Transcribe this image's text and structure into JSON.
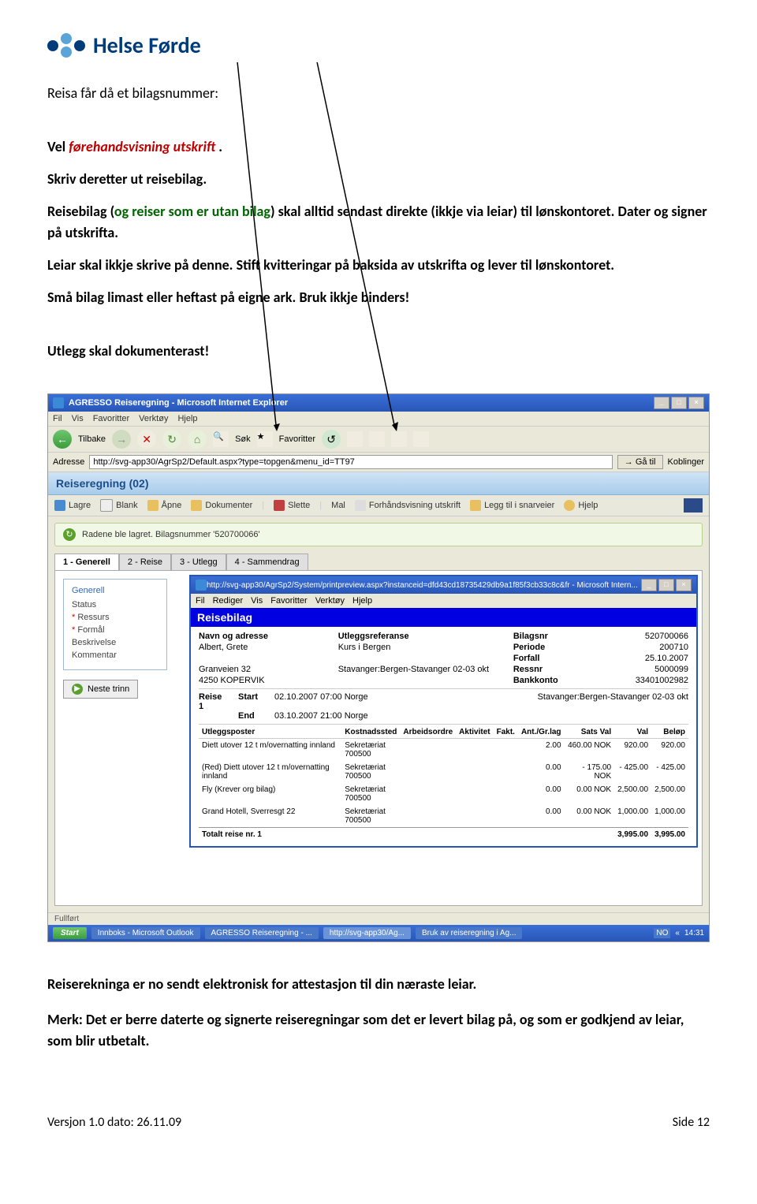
{
  "logo_text": "Helse Førde",
  "doc": {
    "p1": "Reisa får då et bilagsnummer:",
    "p2_pre": "Vel ",
    "p2_red": "førehandsvisning utskrift",
    "p2_post": " .",
    "p3": "Skriv deretter ut reisebilag.",
    "p4_pre": "Reisebilag (",
    "p4_green": "og reiser som er utan bilag",
    "p4_post": ") skal alltid sendast direkte (ikkje via leiar) til lønskontoret. Dater og signer på utskrifta.",
    "p5": "Leiar skal ikkje skrive på denne. Stift kvitteringar på baksida av utskrifta og lever til lønskontoret.",
    "p6": "Små bilag limast eller heftast på eigne ark. Bruk ikkje binders!",
    "p7": "Utlegg skal dokumenterast!"
  },
  "ie": {
    "title": "AGRESSO Reiseregning - Microsoft Internet Explorer",
    "menu": [
      "Fil",
      "Vis",
      "Favoritter",
      "Verktøy",
      "Hjelp"
    ],
    "back_label": "Tilbake",
    "sok_label": "Søk",
    "fav_label": "Favoritter",
    "addr_label": "Adresse",
    "addr_value": "http://svg-app30/AgrSp2/Default.aspx?type=topgen&menu_id=TT97",
    "go_label": "Gå til",
    "koblinger": "Koblinger"
  },
  "app": {
    "header": "Reiseregning (02)",
    "toolbar": {
      "lagre": "Lagre",
      "blank": "Blank",
      "apne": "Åpne",
      "dokumenter": "Dokumenter",
      "slette": "Slette",
      "mal": "Mal",
      "forhands": "Forhåndsvisning utskrift",
      "snarveier": "Legg til i snarveier",
      "hjelp": "Hjelp"
    },
    "status_msg": "Radene ble lagret. Bilagsnummer '520700066'",
    "tabs": [
      "1 - Generell",
      "2 - Reise",
      "3 - Utlegg",
      "4 - Sammendrag"
    ],
    "fieldset": {
      "legend": "Generell",
      "status": "Status",
      "ressurs": "Ressurs",
      "formal": "Formål",
      "beskrivelse": "Beskrivelse",
      "kommentar": "Kommentar"
    },
    "neste": "Neste trinn"
  },
  "subwin": {
    "title": "http://svg-app30/AgrSp2/System/printpreview.aspx?instanceid=dfd43cd18735429db9a1f85f3cb33c8c&fr - Microsoft Intern...",
    "menu": [
      "Fil",
      "Rediger",
      "Vis",
      "Favoritter",
      "Verktøy",
      "Hjelp"
    ],
    "header": "Reisebilag",
    "labels": {
      "navn": "Navn og adresse",
      "utleggsref": "Utleggsreferanse",
      "bilagsnr": "Bilagsnr",
      "periode": "Periode",
      "forfall": "Forfall",
      "ressnr": "Ressnr",
      "bankkonto": "Bankkonto"
    },
    "values": {
      "navn": "Albert, Grete",
      "addr1": "Granveien 32",
      "addr2": "4250 KOPERVIK",
      "utleggsref": "Kurs i Bergen",
      "utleggsref2": "Stavanger:Bergen-Stavanger 02-03 okt",
      "bilagsnr": "520700066",
      "periode": "200710",
      "forfall": "25.10.2007",
      "ressnr": "5000099",
      "bankkonto": "33401002982"
    },
    "reise": {
      "label": "Reise",
      "num": "1",
      "start": "Start",
      "start_val": "02.10.2007 07:00  Norge",
      "end": "End",
      "end_val": "03.10.2007 21:00  Norge",
      "route": "Stavanger:Bergen-Stavanger 02-03 okt"
    },
    "table_headers": [
      "Utleggsposter",
      "Kostnadssted",
      "Arbeidsordre",
      "Aktivitet",
      "Fakt.",
      "Ant./Gr.lag",
      "Sats Val",
      "Val",
      "Beløp"
    ],
    "rows": [
      {
        "desc": "Diett utover 12 t m/overnatting innland",
        "kst": "Sekretæriat\n700500",
        "ant": "2.00",
        "sats": "460.00 NOK",
        "val": "920.00",
        "belop": "920.00"
      },
      {
        "desc": "(Red) Diett utover 12 t m/overnatting innland",
        "kst": "Sekretæriat\n700500",
        "ant": "0.00",
        "sats": "- 175.00 NOK",
        "val": "- 425.00",
        "belop": "- 425.00"
      },
      {
        "desc": "Fly (Krever org bilag)",
        "kst": "Sekretæriat\n700500",
        "ant": "0.00",
        "sats": "0.00 NOK",
        "val": "2,500.00",
        "belop": "2,500.00"
      },
      {
        "desc": "Grand Hotell, Sverresgt 22",
        "kst": "Sekretæriat\n700500",
        "ant": "0.00",
        "sats": "0.00 NOK",
        "val": "1,000.00",
        "belop": "1,000.00"
      }
    ],
    "total_label": "Totalt reise nr. 1",
    "total_val": "3,995.00",
    "total_belop": "3,995.00"
  },
  "taskbar": {
    "start": "Start",
    "items": [
      "Innboks - Microsoft Outlook",
      "AGRESSO Reiseregning - ...",
      "http://svg-app30/Ag...",
      "Bruk av reiseregning i Ag..."
    ],
    "fullfort": "Fullført",
    "time": "14:31"
  },
  "footer": {
    "p1": "Reiserekninga er no sendt elektronisk for attestasjon til din næraste leiar.",
    "p2": "Merk: Det er berre daterte og signerte reiseregningar som det er levert bilag på, og som er godkjend av leiar, som blir utbetalt."
  },
  "page_footer": {
    "left": "Versjon 1.0    dato: 26.11.09",
    "right": "Side 12"
  }
}
